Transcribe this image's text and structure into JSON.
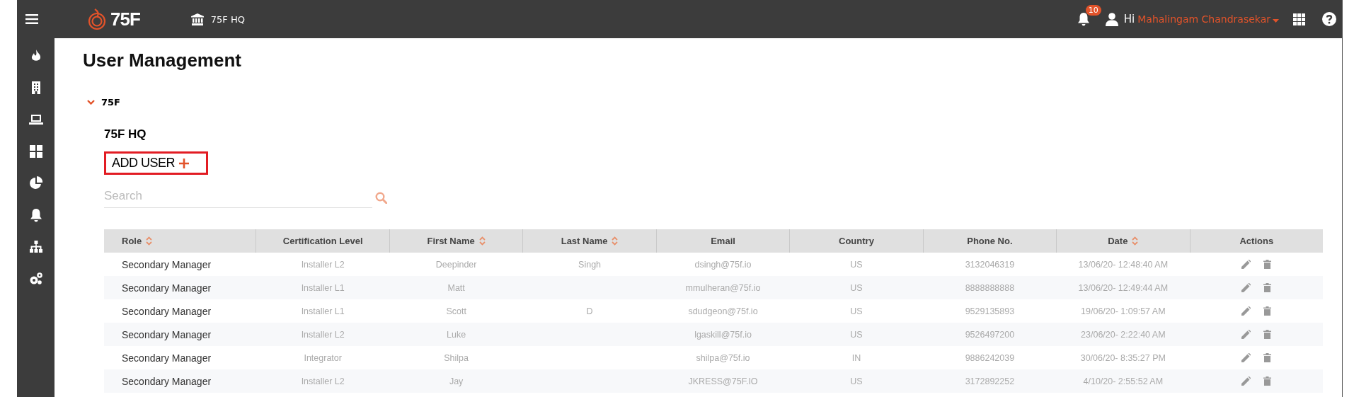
{
  "topbar": {
    "logo_text": "75F",
    "site": "75F HQ",
    "notification_count": "10",
    "greeting": "Hi",
    "user_name": "Mahalingam Chandrasekar"
  },
  "page_title": "User Management",
  "tree": {
    "label": "75F",
    "expanded": true,
    "site": "75F HQ"
  },
  "add_user_label": "ADD USER",
  "search": {
    "placeholder": "Search"
  },
  "table": {
    "columns": [
      {
        "label": "Role",
        "sortable": true
      },
      {
        "label": "Certification Level",
        "sortable": false
      },
      {
        "label": "First Name",
        "sortable": true
      },
      {
        "label": "Last Name",
        "sortable": true
      },
      {
        "label": "Email",
        "sortable": false
      },
      {
        "label": "Country",
        "sortable": false
      },
      {
        "label": "Phone No.",
        "sortable": false
      },
      {
        "label": "Date",
        "sortable": true
      },
      {
        "label": "Actions",
        "sortable": false
      }
    ],
    "rows": [
      {
        "cells": [
          "Secondary Manager",
          "Installer L2",
          "Deepinder",
          "Singh",
          "dsingh@75f.io",
          "US",
          "3132046319",
          "13/06/20- 12:48:40 AM"
        ]
      },
      {
        "cells": [
          "Secondary Manager",
          "Installer L1",
          "Matt",
          "",
          "mmulheran@75f.io",
          "US",
          "8888888888",
          "13/06/20- 12:49:44 AM"
        ]
      },
      {
        "cells": [
          "Secondary Manager",
          "Installer L1",
          "Scott",
          "D",
          "sdudgeon@75f.io",
          "US",
          "9529135893",
          "19/06/20- 1:09:57 AM"
        ]
      },
      {
        "cells": [
          "Secondary Manager",
          "Installer L2",
          "Luke",
          "",
          "lgaskill@75f.io",
          "US",
          "9526497200",
          "23/06/20- 2:22:40 AM"
        ]
      },
      {
        "cells": [
          "Secondary Manager",
          "Integrator",
          "Shilpa",
          "",
          "shilpa@75f.io",
          "IN",
          "9886242039",
          "30/06/20- 8:35:27 PM"
        ]
      },
      {
        "cells": [
          "Secondary Manager",
          "Installer L2",
          "Jay",
          "",
          "JKRESS@75F.IO",
          "US",
          "3172892252",
          "4/10/20- 2:55:52 AM"
        ]
      }
    ]
  }
}
